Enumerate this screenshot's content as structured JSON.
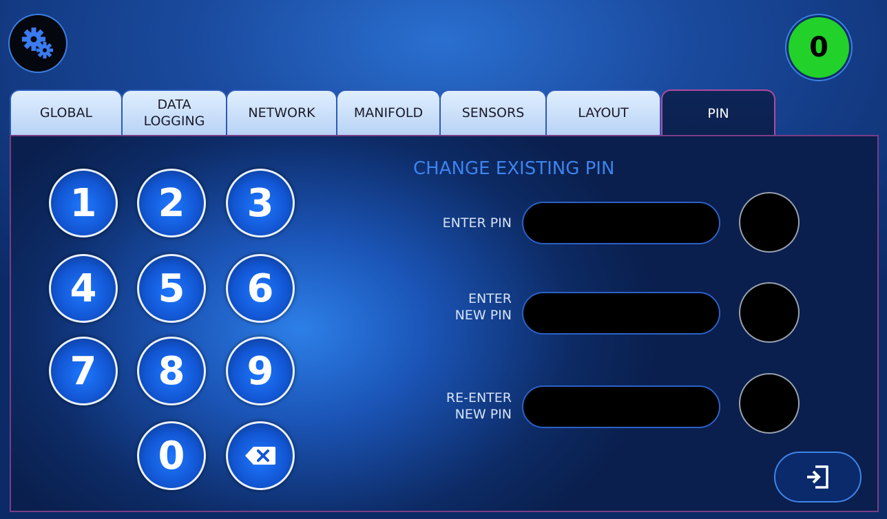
{
  "header": {
    "settings_icon": "gears-icon",
    "counter_value": "0",
    "counter_color": "#22d22a"
  },
  "tabs": [
    {
      "label": "GLOBAL",
      "active": false
    },
    {
      "label": "DATA\nLOGGING",
      "active": false
    },
    {
      "label": "NETWORK",
      "active": false
    },
    {
      "label": "MANIFOLD",
      "active": false
    },
    {
      "label": "SENSORS",
      "active": false
    },
    {
      "label": "LAYOUT",
      "active": false
    },
    {
      "label": "PIN",
      "active": true
    }
  ],
  "keypad": {
    "keys": [
      "1",
      "2",
      "3",
      "4",
      "5",
      "6",
      "7",
      "8",
      "9",
      "0"
    ],
    "backspace_icon": "backspace-icon"
  },
  "pin_form": {
    "heading": "CHANGE EXISTING PIN",
    "enter_pin_label": "ENTER PIN",
    "enter_new_label_1": "ENTER",
    "enter_new_label_2": "NEW PIN",
    "reenter_label_1": "RE-ENTER",
    "reenter_label_2": "NEW PIN",
    "enter_pin_value": "",
    "new_pin_value": "",
    "reenter_pin_value": ""
  },
  "exit": {
    "icon": "exit-icon"
  },
  "colors": {
    "accent": "#3d84ee",
    "active_tab_border": "#b44a9e"
  }
}
